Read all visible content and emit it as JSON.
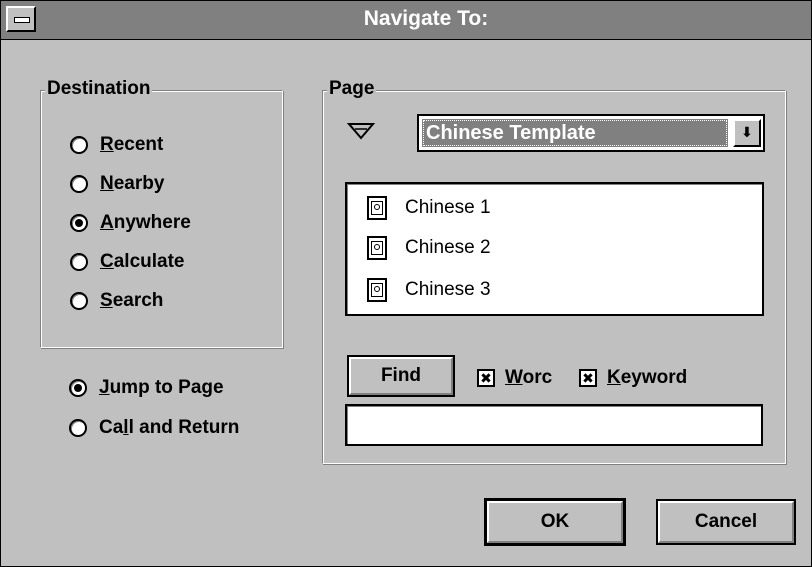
{
  "window": {
    "title": "Navigate To:"
  },
  "destination": {
    "label": "Destination",
    "options": [
      {
        "pre": "",
        "key": "R",
        "post": "ecent",
        "checked": false
      },
      {
        "pre": "",
        "key": "N",
        "post": "earby",
        "checked": false
      },
      {
        "pre": "",
        "key": "A",
        "post": "nywhere",
        "checked": true
      },
      {
        "pre": "",
        "key": "C",
        "post": "alculate",
        "checked": false
      },
      {
        "pre": "",
        "key": "S",
        "post": "earch",
        "checked": false
      }
    ]
  },
  "mode": {
    "options": [
      {
        "pre": "",
        "key": "J",
        "post": "ump to Page",
        "checked": true
      },
      {
        "pre": "Ca",
        "key": "l",
        "post": "l and Return",
        "checked": false
      }
    ]
  },
  "page": {
    "label": "Page",
    "combo_value": "Chinese Template",
    "combo_arrow": "⬇",
    "items": [
      "Chinese 1",
      "Chinese 2",
      "Chinese 3"
    ]
  },
  "search": {
    "find_label": "Find",
    "word": {
      "pre": "",
      "key": "W",
      "post": "orc",
      "checked": true
    },
    "keyword": {
      "pre": "",
      "key": "K",
      "post": "eyword",
      "checked": true
    },
    "check_mark": "✖",
    "input_value": ""
  },
  "buttons": {
    "ok": "OK",
    "cancel": "Cancel"
  },
  "colors": {
    "face": "#c0c0c0",
    "titlebar": "#808080",
    "highlight": "#ffffff",
    "shadow": "#808080"
  },
  "icons": {
    "pointer": "triangle-down-icon",
    "page_item": "page-document-icon"
  }
}
